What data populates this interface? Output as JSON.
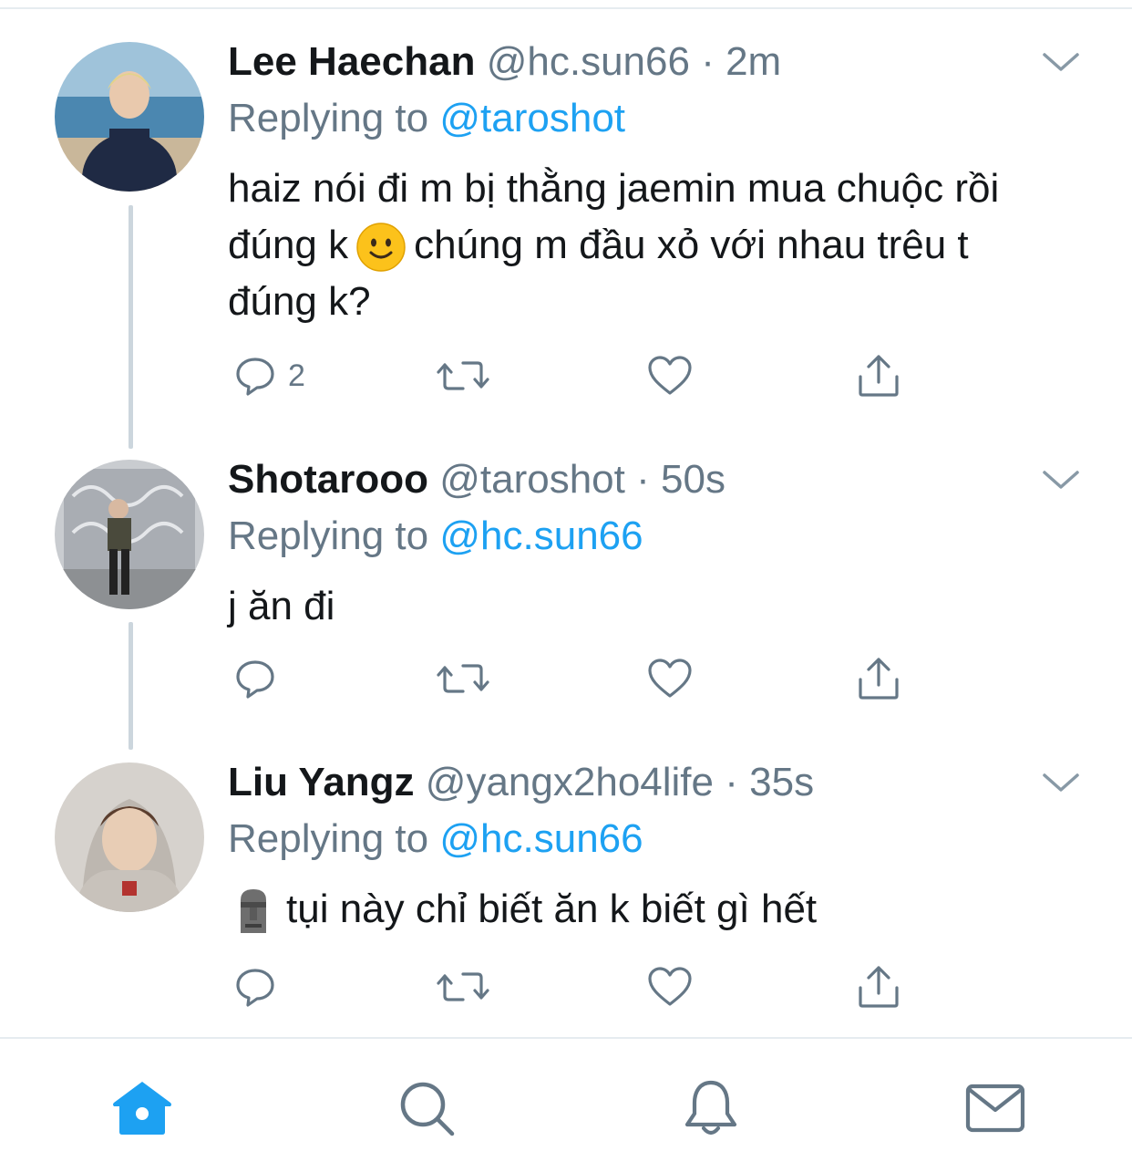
{
  "tweets": [
    {
      "name": "Lee Haechan",
      "handle": "@hc.sun66",
      "dot": "·",
      "time": "2m",
      "replying_prefix": "Replying to",
      "replying_to": "@taroshot",
      "text_part1": "haiz nói đi m bị thằng jaemin mua chuộc rồi đúng k",
      "emoji": "slightly-smiling-face",
      "text_part2": "chúng m đầu xỏ với nhau trêu t đúng k?",
      "reply_count": "2"
    },
    {
      "name": "Shotarooo",
      "handle": "@taroshot",
      "dot": "·",
      "time": "50s",
      "replying_prefix": "Replying to",
      "replying_to": "@hc.sun66",
      "text": "j ăn đi",
      "reply_count": ""
    },
    {
      "name": "Liu Yangz",
      "handle": "@yangx2ho4life",
      "dot": "·",
      "time": "35s",
      "replying_prefix": "Replying to",
      "replying_to": "@hc.sun66",
      "emoji": "moai",
      "text": "tụi này chỉ biết ăn k biết gì hết",
      "reply_count": ""
    }
  ],
  "icons": {
    "reply": "reply-icon",
    "retweet": "retweet-icon",
    "like": "heart-icon",
    "share": "share-icon",
    "more": "chevron-down-icon"
  },
  "tabbar": {
    "items": [
      "home-icon",
      "search-icon",
      "notifications-icon",
      "messages-icon"
    ],
    "active": "home-icon"
  },
  "colors": {
    "accent": "#1da1f2",
    "secondary_text": "#657786",
    "icon_gray": "#657786",
    "thread_line": "#ccd6dd"
  }
}
